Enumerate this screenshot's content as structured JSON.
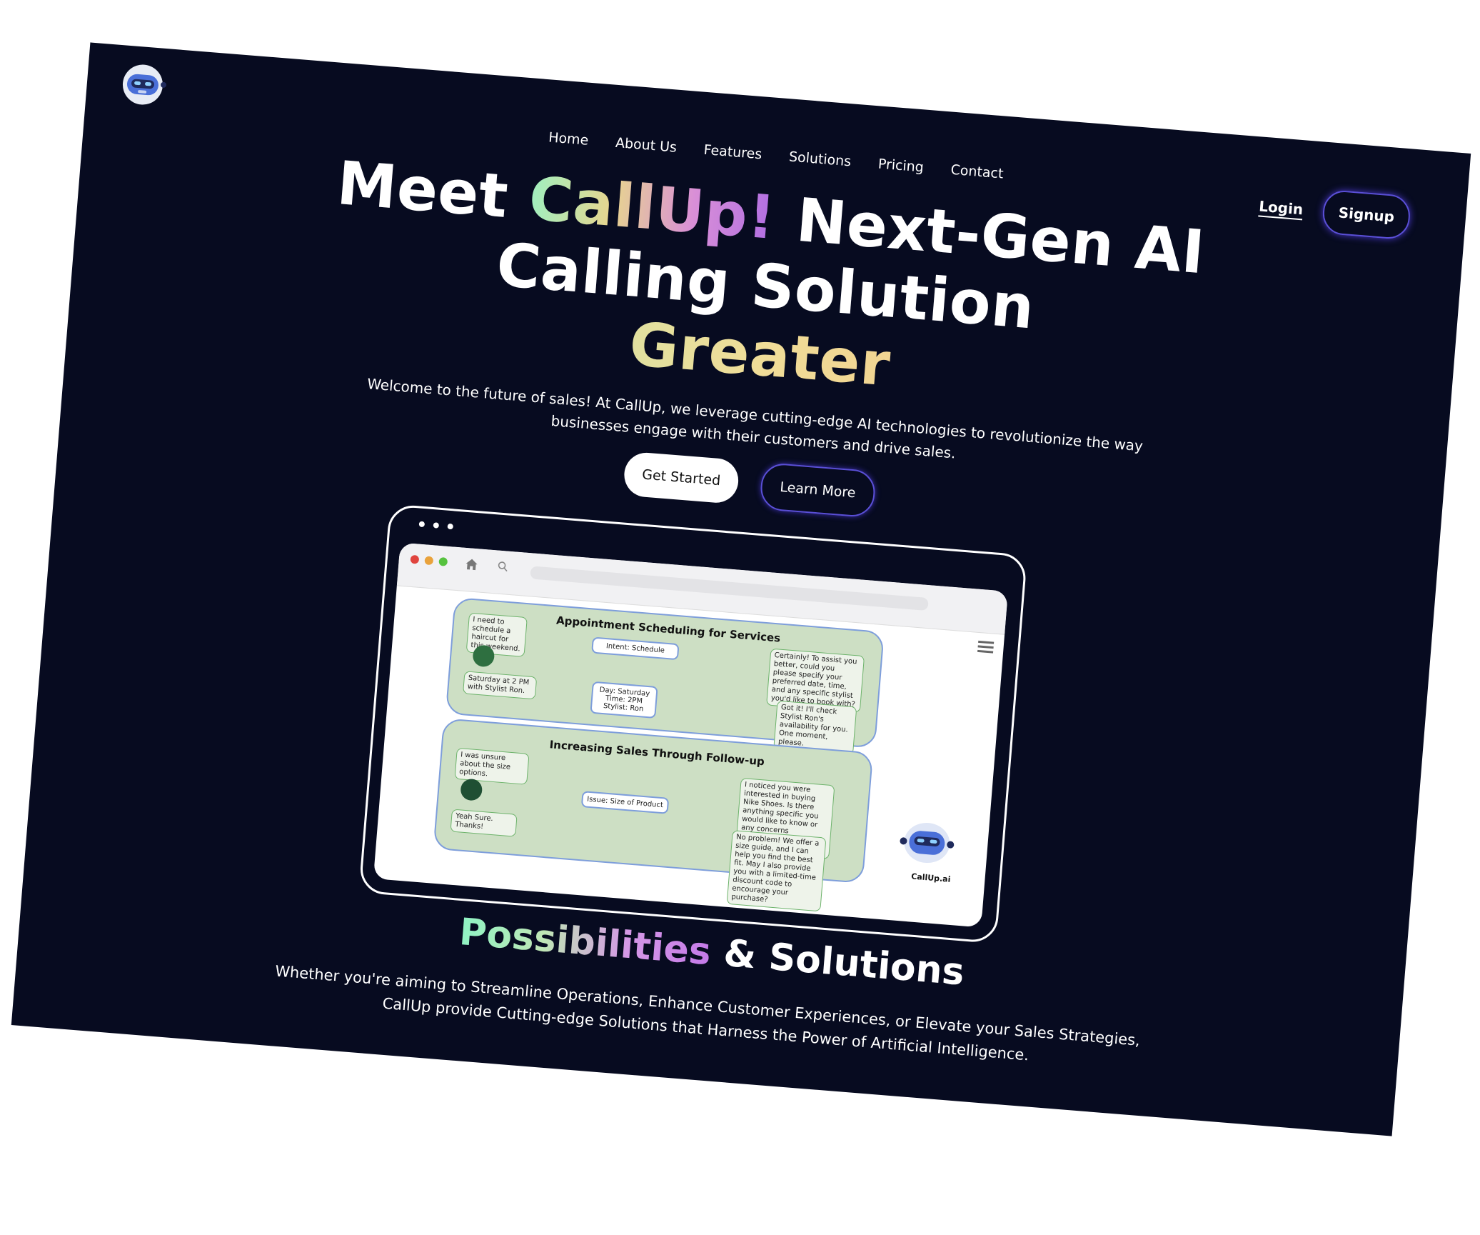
{
  "nav": {
    "items": [
      "Home",
      "About Us",
      "Features",
      "Solutions",
      "Pricing",
      "Contact"
    ],
    "login": "Login",
    "signup": "Signup"
  },
  "hero": {
    "meet": "Meet",
    "brand": "CallUp!",
    "line1_rest": "Next-Gen AI",
    "line2": "Calling Solution",
    "line3": "Greater",
    "subtitle": "Welcome to the future of sales! At CallUp, we leverage cutting-edge AI technologies to revolutionize the way businesses engage with their customers and drive sales.",
    "get_started": "Get Started",
    "learn_more": "Learn More"
  },
  "diagram": {
    "panel1_title": "Appointment Scheduling for Services",
    "p1_user_msg1": "I need to schedule a haircut for this weekend.",
    "p1_intent": "Intent: Schedule",
    "p1_bot_msg1": "Certainly! To assist you better, could you please specify your preferred date, time, and any specific stylist you'd like to book with?",
    "p1_user_msg2": "Saturday at 2 PM with Stylist Ron.",
    "p1_slots": "Day: Saturday\nTime: 2PM\nStylist: Ron",
    "p1_bot_msg2": "Got it! I'll check Stylist Ron's availability for you. One moment, please.",
    "panel2_title": "Increasing Sales Through Follow-up",
    "p2_user_msg1": "I was unsure about the size options.",
    "p2_bot_msg1": "I noticed you were interested in buying Nike Shoes. Is there anything specific you would like to know or any concerns preventing you from making a purchase?",
    "p2_issue": "Issue: Size of Product",
    "p2_user_msg2": "Yeah Sure. Thanks!",
    "p2_bot_msg2": "No problem! We offer a size guide, and I can help you find the best fit. May I also provide you with a limited-time discount code to encourage your purchase?",
    "bot_label": "CallUp.ai"
  },
  "section2": {
    "title_grad": "Possibilities",
    "title_rest": "& Solutions",
    "subtitle": "Whether you're aiming to Streamline Operations, Enhance Customer Experiences, or Elevate your Sales Strategies, CallUp provide Cutting-edge Solutions that Harness the Power of Artificial Intelligence."
  },
  "colors": {
    "background": "#070b20",
    "accent_border": "#5a4fd6",
    "panel_fill": "#cddfc4"
  }
}
